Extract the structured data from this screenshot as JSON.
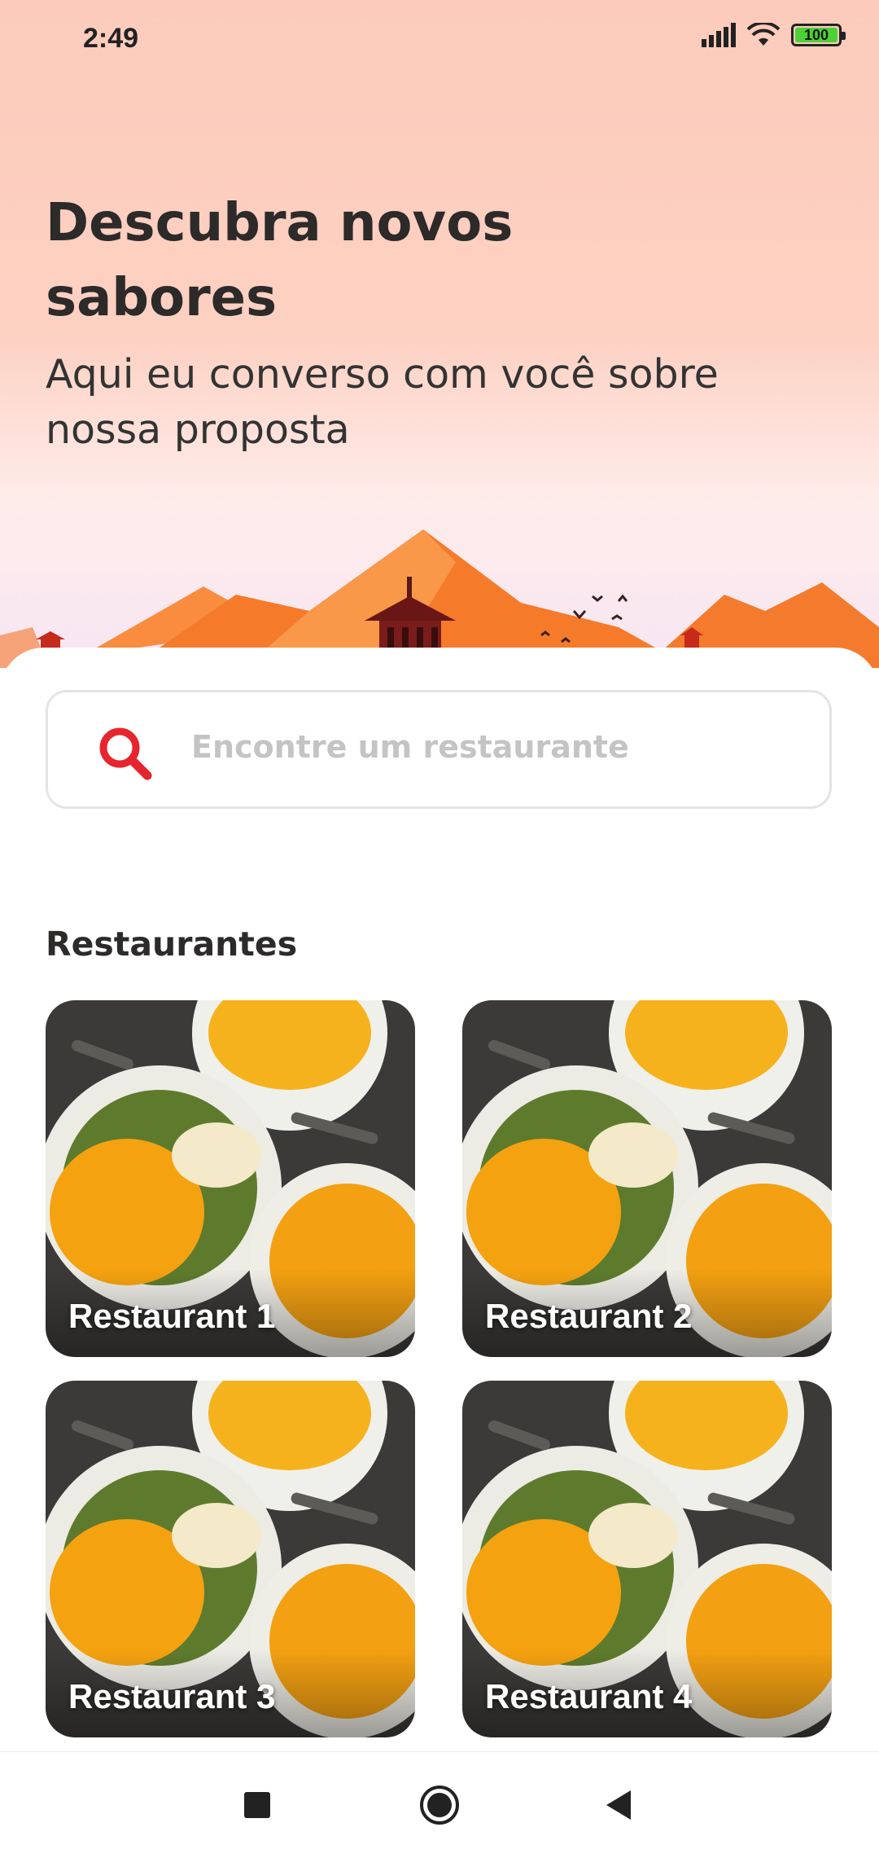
{
  "status_bar": {
    "time": "2:49",
    "battery": "100",
    "icons": [
      "signal-icon",
      "wifi-icon",
      "battery-icon"
    ]
  },
  "hero": {
    "title": "Descubra novos sabores",
    "subtitle": "Aqui eu converso com você sobre nossa proposta"
  },
  "search": {
    "placeholder": "Encontre um restaurante",
    "icon": "search-icon"
  },
  "section": {
    "title": "Restaurantes"
  },
  "restaurants": [
    {
      "name": "Restaurant 1"
    },
    {
      "name": "Restaurant 2"
    },
    {
      "name": "Restaurant 3"
    },
    {
      "name": "Restaurant 4"
    }
  ],
  "nav": {
    "buttons": [
      "recents-square-icon",
      "home-circle-icon",
      "back-triangle-icon"
    ]
  },
  "colors": {
    "accent": "#e5262e",
    "hero_bg": "#fccbbb",
    "text_dark": "#2d2a2a",
    "placeholder": "#c4c4c4"
  }
}
